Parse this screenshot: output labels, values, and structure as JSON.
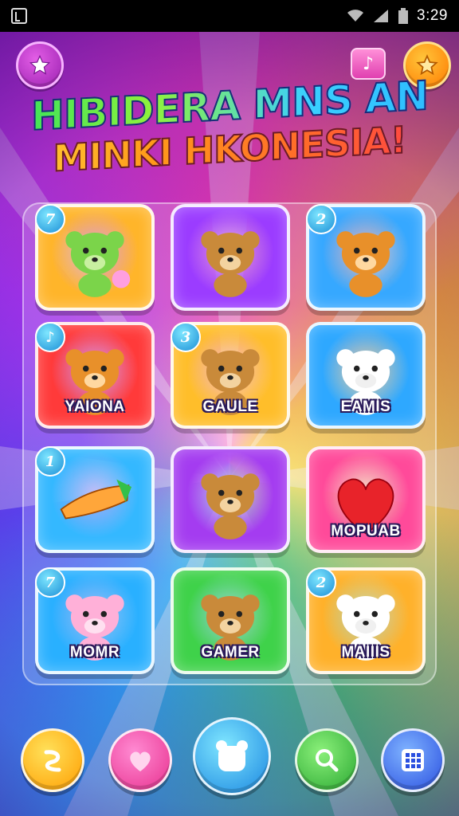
{
  "status_bar": {
    "time": "3:29"
  },
  "title": {
    "line1": "HIBIDERA MNS AN",
    "line2": "MINKI HKONESIA!"
  },
  "top_buttons": [
    {
      "name": "star-button",
      "icon": "star-icon",
      "color": "#b22fc4"
    },
    {
      "name": "star-button",
      "icon": "star-icon",
      "color": "#ff9a1a"
    }
  ],
  "cards": [
    {
      "number": "7",
      "label": "",
      "color": "#ffb52a",
      "icon": "green-bear-icon"
    },
    {
      "number": "",
      "label": "",
      "color": "#9b3cff",
      "icon": "brown-bear-icon"
    },
    {
      "number": "2",
      "label": "",
      "color": "#36a8ff",
      "icon": "orange-bear-icon"
    },
    {
      "number": "♪",
      "label": "YAIONA",
      "color": "#ff3a3a",
      "icon": "orange-bear-icon"
    },
    {
      "number": "3",
      "label": "GAULE",
      "color": "#ffbe2a",
      "icon": "brown-bear-icon"
    },
    {
      "number": "",
      "label": "EAMIS",
      "color": "#2ea8ff",
      "icon": "white-bear-icon"
    },
    {
      "number": "1",
      "label": "",
      "color": "#34b8ff",
      "icon": "rocket-icon"
    },
    {
      "number": "",
      "label": "",
      "color": "#a43cf0",
      "icon": "brown-bear-icon"
    },
    {
      "number": "",
      "label": "MOPUAB",
      "color": "#ff4a9a",
      "icon": "heart-icon"
    },
    {
      "number": "7",
      "label": "MOMR",
      "color": "#29b0ff",
      "icon": "pink-bear-icon"
    },
    {
      "number": "",
      "label": "GAMER",
      "color": "#3fd24a",
      "icon": "brown-bear-icon"
    },
    {
      "number": "2",
      "label": "MAIIIS",
      "color": "#ffb12a",
      "icon": "white-bear-icon"
    }
  ],
  "bottom_buttons": [
    {
      "name": "curve-button",
      "icon": "curve-icon"
    },
    {
      "name": "heart-button",
      "icon": "heart-icon"
    },
    {
      "name": "home-button",
      "icon": "bear-icon"
    },
    {
      "name": "search-button",
      "icon": "search-icon"
    },
    {
      "name": "menu-grid-button",
      "icon": "grid-icon"
    }
  ]
}
